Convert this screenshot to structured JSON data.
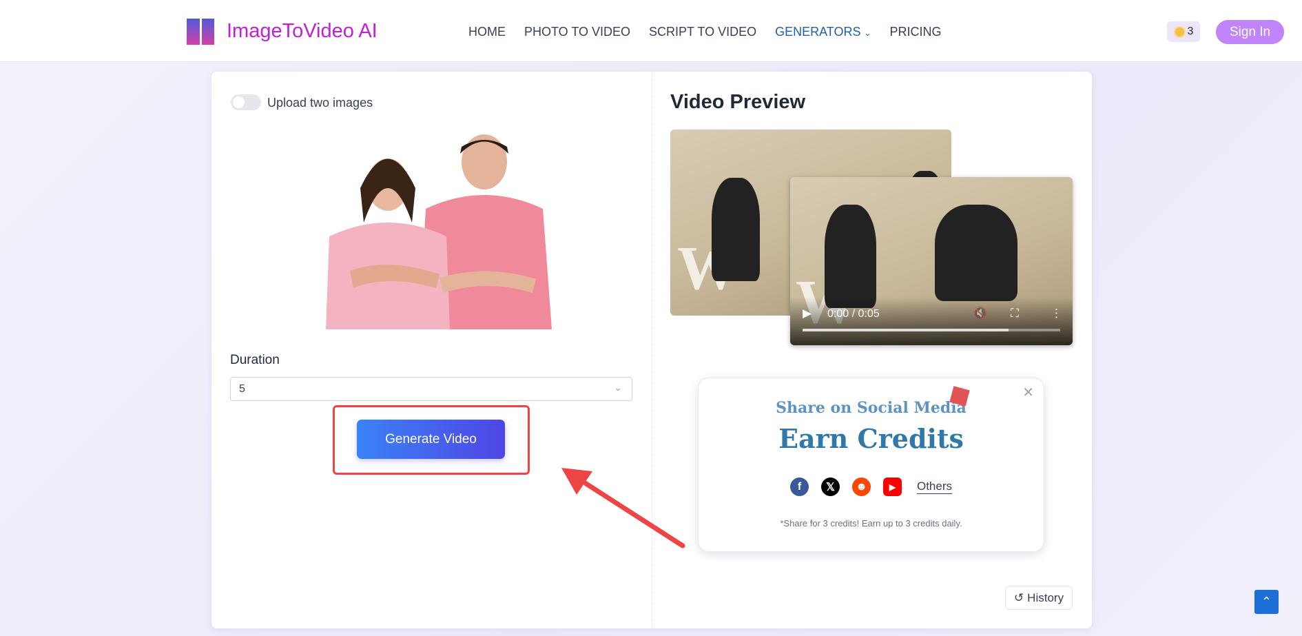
{
  "header": {
    "logo_text": "ImageToVideo AI",
    "nav": [
      "HOME",
      "PHOTO TO VIDEO",
      "SCRIPT TO VIDEO",
      "GENERATORS",
      "PRICING"
    ],
    "credits": "3",
    "sign_in": "Sign In"
  },
  "left": {
    "toggle_label": "Upload two images",
    "toggle_on": false,
    "duration_label": "Duration",
    "duration_value": "5",
    "generate_label": "Generate Video"
  },
  "right": {
    "title": "Video Preview",
    "video_time": "0:00 / 0:05",
    "video_progress": 0.8,
    "history_label": "History"
  },
  "popup": {
    "subtitle": "Share on Social Media",
    "title": "Earn Credits",
    "others": "Others",
    "note": "*Share for 3 credits! Earn up to 3 credits daily.",
    "socials": [
      "facebook",
      "x",
      "reddit",
      "youtube"
    ]
  },
  "colors": {
    "brand": "#c21fd6",
    "sign_in": "#c084fc",
    "generate": "#4f46e5",
    "annotation": "#ef4444"
  }
}
